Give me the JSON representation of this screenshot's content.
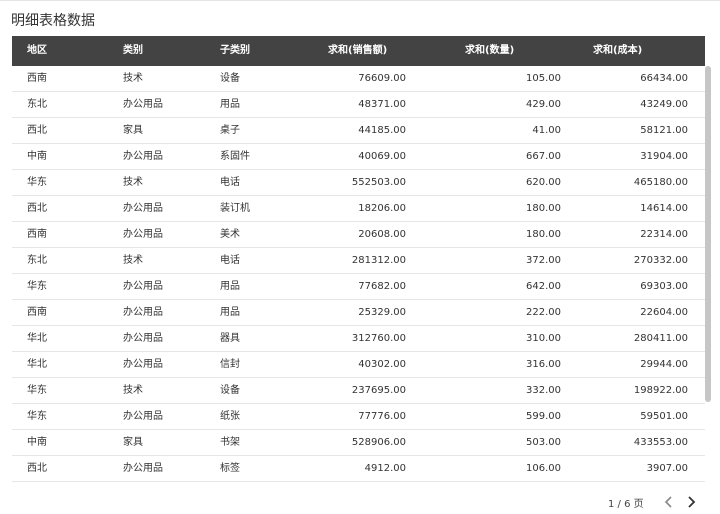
{
  "title": "明细表格数据",
  "table": {
    "headers": [
      "地区",
      "类别",
      "子类别",
      "求和(销售额)",
      "求和(数量)",
      "求和(成本)"
    ],
    "rows": [
      [
        "西南",
        "技术",
        "设备",
        "76609.00",
        "105.00",
        "66434.00"
      ],
      [
        "东北",
        "办公用品",
        "用品",
        "48371.00",
        "429.00",
        "43249.00"
      ],
      [
        "西北",
        "家具",
        "桌子",
        "44185.00",
        "41.00",
        "58121.00"
      ],
      [
        "中南",
        "办公用品",
        "系固件",
        "40069.00",
        "667.00",
        "31904.00"
      ],
      [
        "华东",
        "技术",
        "电话",
        "552503.00",
        "620.00",
        "465180.00"
      ],
      [
        "西北",
        "办公用品",
        "装订机",
        "18206.00",
        "180.00",
        "14614.00"
      ],
      [
        "西南",
        "办公用品",
        "美术",
        "20608.00",
        "180.00",
        "22314.00"
      ],
      [
        "东北",
        "技术",
        "电话",
        "281312.00",
        "372.00",
        "270332.00"
      ],
      [
        "华东",
        "办公用品",
        "用品",
        "77682.00",
        "642.00",
        "69303.00"
      ],
      [
        "西南",
        "办公用品",
        "用品",
        "25329.00",
        "222.00",
        "22604.00"
      ],
      [
        "华北",
        "办公用品",
        "器具",
        "312760.00",
        "310.00",
        "280411.00"
      ],
      [
        "华北",
        "办公用品",
        "信封",
        "40302.00",
        "316.00",
        "29944.00"
      ],
      [
        "华东",
        "技术",
        "设备",
        "237695.00",
        "332.00",
        "198922.00"
      ],
      [
        "华东",
        "办公用品",
        "纸张",
        "77776.00",
        "599.00",
        "59501.00"
      ],
      [
        "中南",
        "家具",
        "书架",
        "528906.00",
        "503.00",
        "433553.00"
      ],
      [
        "西北",
        "办公用品",
        "标签",
        "4912.00",
        "106.00",
        "3907.00"
      ]
    ]
  },
  "pagination": {
    "info": "1 / 6 页",
    "prev_icon": "chevron-left-icon",
    "next_icon": "chevron-right-icon"
  },
  "colors": {
    "header_bg": "#434343",
    "header_text": "#ffffff",
    "row_border": "#e6e6e6",
    "scrollbar": "#c6c6c6"
  }
}
